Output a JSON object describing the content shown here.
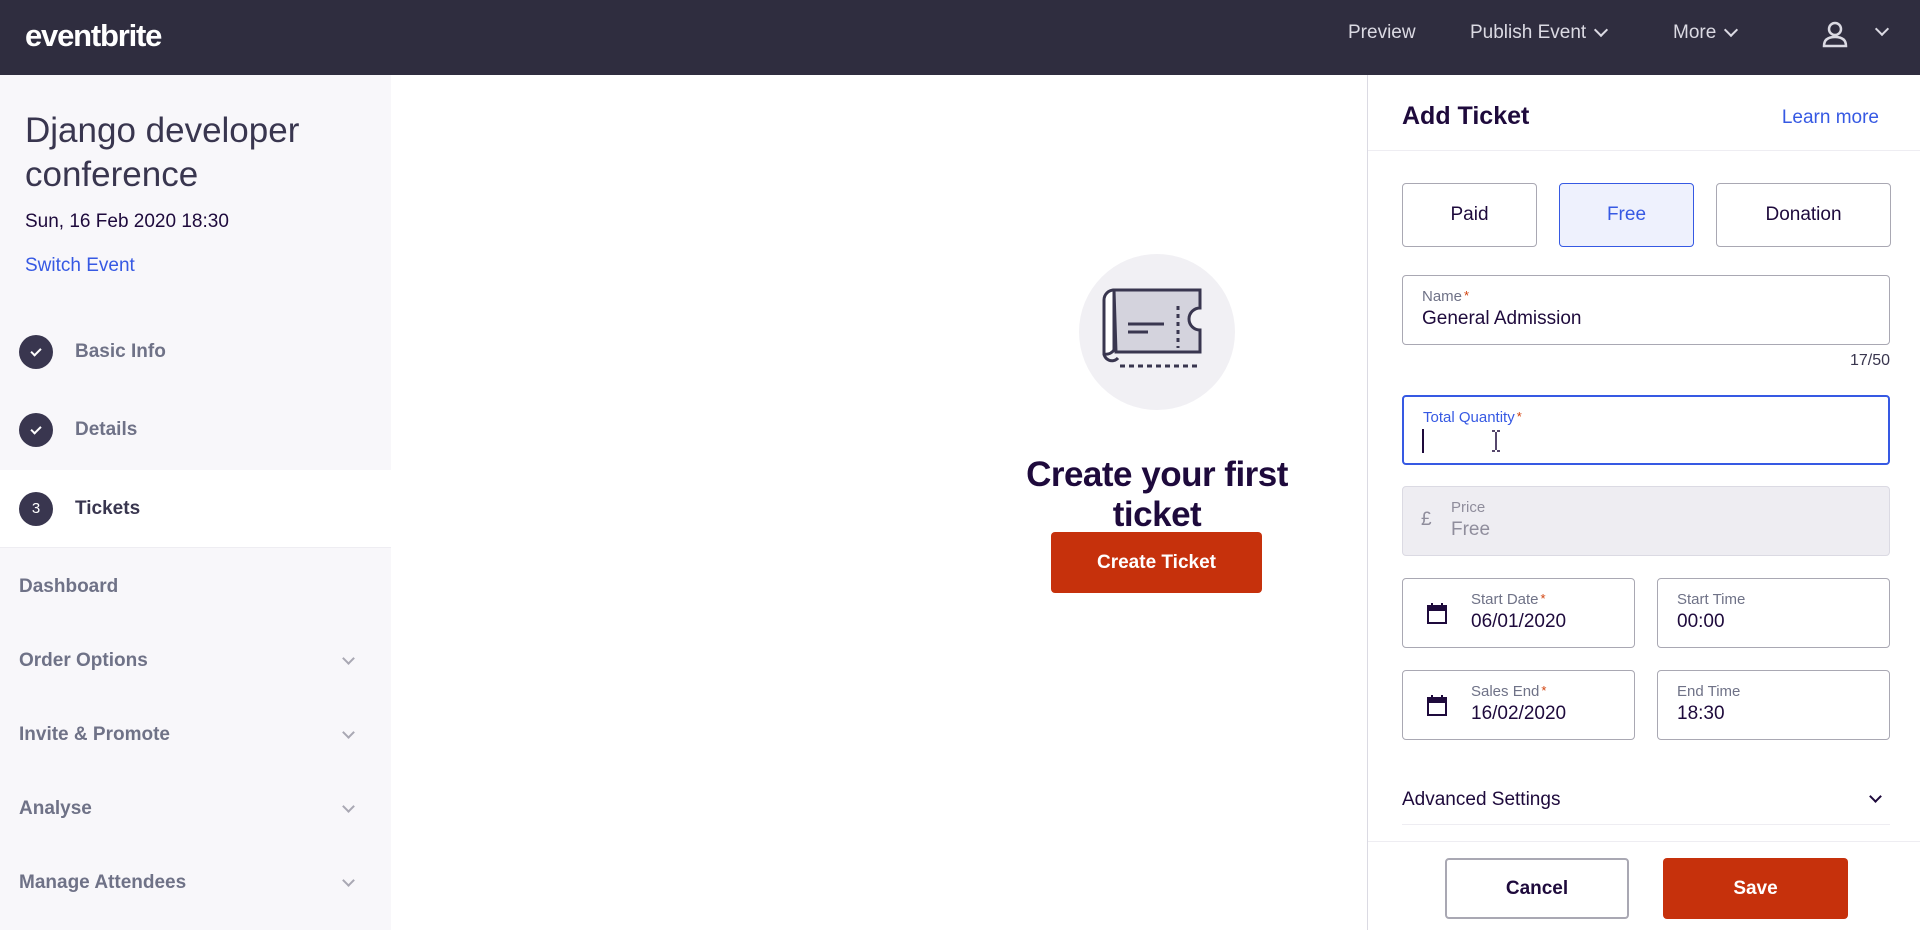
{
  "topbar": {
    "logo": "eventbrite",
    "preview": "Preview",
    "publish": "Publish Event",
    "more": "More",
    "user_icon": "user-icon"
  },
  "sidebar": {
    "event_title": "Django developer conference",
    "event_date": "Sun, 16 Feb 2020 18:30",
    "switch_event": "Switch Event",
    "steps": [
      {
        "label": "Basic Info",
        "state": "done"
      },
      {
        "label": "Details",
        "state": "done"
      },
      {
        "label": "Tickets",
        "state": "active",
        "number": "3"
      }
    ],
    "links": [
      {
        "label": "Dashboard"
      },
      {
        "label": "Order Options"
      },
      {
        "label": "Invite & Promote"
      },
      {
        "label": "Analyse"
      },
      {
        "label": "Manage Attendees"
      }
    ]
  },
  "main": {
    "empty_title": "Create your first ticket",
    "create_button": "Create Ticket",
    "illustration": "ticket-icon"
  },
  "panel": {
    "title": "Add Ticket",
    "learn_more": "Learn more",
    "types": [
      "Paid",
      "Free",
      "Donation"
    ],
    "selected_type": "Free",
    "name": {
      "label": "Name",
      "value": "General Admission",
      "counter": "17/50",
      "required": "*"
    },
    "quantity": {
      "label": "Total Quantity",
      "value": "",
      "required": "*"
    },
    "price": {
      "label": "Price",
      "currency": "£",
      "value": "Free"
    },
    "start_date": {
      "label": "Start Date",
      "value": "06/01/2020",
      "required": "*"
    },
    "start_time": {
      "label": "Start Time",
      "value": "00:00"
    },
    "sales_end": {
      "label": "Sales End",
      "value": "16/02/2020",
      "required": "*"
    },
    "end_time": {
      "label": "End Time",
      "value": "18:30"
    },
    "advanced": "Advanced Settings",
    "cancel": "Cancel",
    "save": "Save"
  },
  "colors": {
    "topbar": "#2f2d3f",
    "accent": "#3659e3",
    "brand_orange": "#c6310c"
  }
}
